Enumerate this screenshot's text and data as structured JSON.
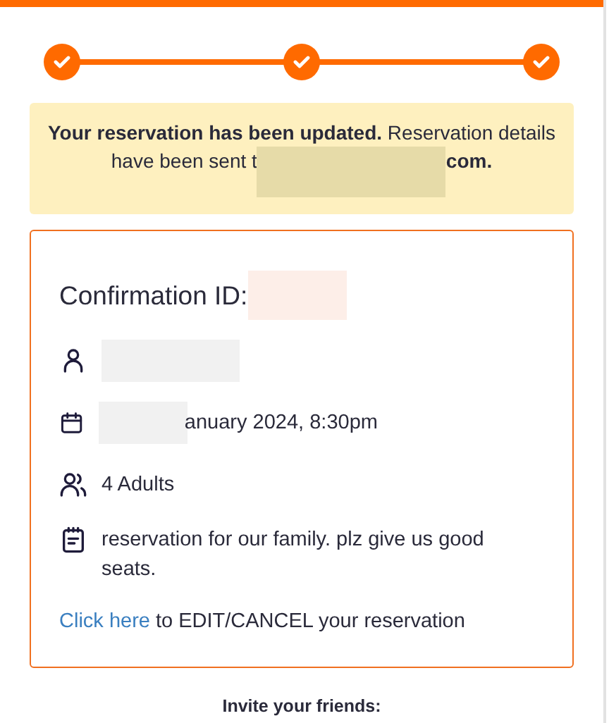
{
  "steps": [
    {
      "completed": true
    },
    {
      "completed": true
    },
    {
      "completed": true
    }
  ],
  "banner": {
    "lead": "**Your reservation has been updated.** Reservation details",
    "lead2": "have been sent t",
    "redacted": true,
    "tail": "com."
  },
  "confirmation": {
    "label": "Confirmation ID:",
    "redacted": true
  },
  "details": [
    {
      "kind": "person",
      "redacted": true
    },
    {
      "kind": "date",
      "redacted": true,
      "text": "anuary 2024, 8:30pm"
    },
    {
      "kind": "guests",
      "text": "4 Adults"
    },
    {
      "kind": "note",
      "text": "reservation for our family. plz give us good seats."
    }
  ],
  "edit": {
    "link": "Click here",
    "text": "to EDIT/CANCEL your reservation"
  },
  "invite": {
    "title": "Invite your friends:"
  }
}
